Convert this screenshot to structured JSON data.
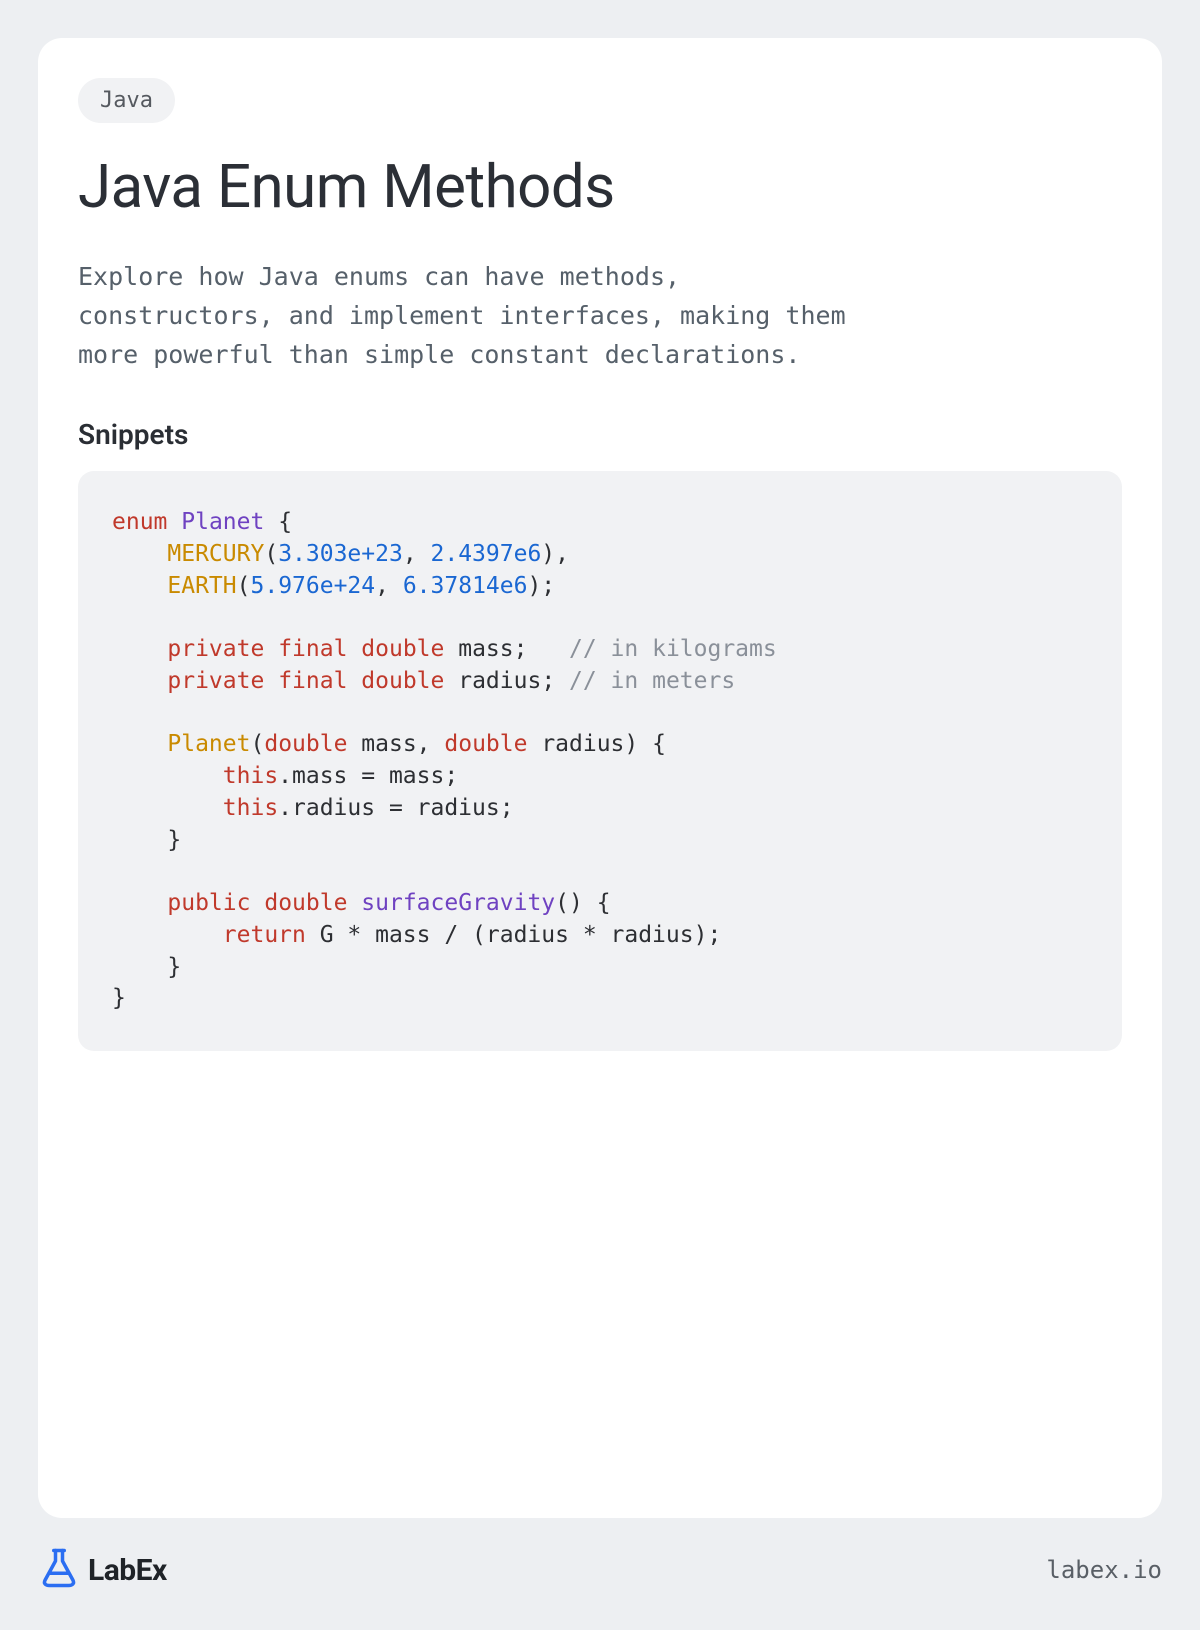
{
  "tag": "Java",
  "title": "Java Enum Methods",
  "description": "Explore how Java enums can have methods, constructors, and implement interfaces, making them more powerful than simple constant declarations.",
  "section_heading": "Snippets",
  "code": {
    "tokens": [
      {
        "t": "enum",
        "c": "tok-kw"
      },
      {
        "t": " "
      },
      {
        "t": "Planet",
        "c": "tok-type"
      },
      {
        "t": " {"
      },
      {
        "nl": true
      },
      {
        "t": "    "
      },
      {
        "t": "MERCURY",
        "c": "tok-const"
      },
      {
        "t": "("
      },
      {
        "t": "3.303e+23",
        "c": "tok-num"
      },
      {
        "t": ", "
      },
      {
        "t": "2.4397e6",
        "c": "tok-num"
      },
      {
        "t": "),"
      },
      {
        "nl": true
      },
      {
        "t": "    "
      },
      {
        "t": "EARTH",
        "c": "tok-const"
      },
      {
        "t": "("
      },
      {
        "t": "5.976e+24",
        "c": "tok-num"
      },
      {
        "t": ", "
      },
      {
        "t": "6.37814e6",
        "c": "tok-num"
      },
      {
        "t": ");"
      },
      {
        "nl": true
      },
      {
        "nl": true
      },
      {
        "t": "    "
      },
      {
        "t": "private",
        "c": "tok-kw"
      },
      {
        "t": " "
      },
      {
        "t": "final",
        "c": "tok-kw"
      },
      {
        "t": " "
      },
      {
        "t": "double",
        "c": "tok-kw"
      },
      {
        "t": " mass;   "
      },
      {
        "t": "// in kilograms",
        "c": "tok-cmt"
      },
      {
        "nl": true
      },
      {
        "t": "    "
      },
      {
        "t": "private",
        "c": "tok-kw"
      },
      {
        "t": " "
      },
      {
        "t": "final",
        "c": "tok-kw"
      },
      {
        "t": " "
      },
      {
        "t": "double",
        "c": "tok-kw"
      },
      {
        "t": " radius; "
      },
      {
        "t": "// in meters",
        "c": "tok-cmt"
      },
      {
        "nl": true
      },
      {
        "nl": true
      },
      {
        "t": "    "
      },
      {
        "t": "Planet",
        "c": "tok-const"
      },
      {
        "t": "("
      },
      {
        "t": "double",
        "c": "tok-kw"
      },
      {
        "t": " mass, "
      },
      {
        "t": "double",
        "c": "tok-kw"
      },
      {
        "t": " radius) {"
      },
      {
        "nl": true
      },
      {
        "t": "        "
      },
      {
        "t": "this",
        "c": "tok-kw"
      },
      {
        "t": ".mass = mass;"
      },
      {
        "nl": true
      },
      {
        "t": "        "
      },
      {
        "t": "this",
        "c": "tok-kw"
      },
      {
        "t": ".radius = radius;"
      },
      {
        "nl": true
      },
      {
        "t": "    }"
      },
      {
        "nl": true
      },
      {
        "nl": true
      },
      {
        "t": "    "
      },
      {
        "t": "public",
        "c": "tok-kw"
      },
      {
        "t": " "
      },
      {
        "t": "double",
        "c": "tok-kw"
      },
      {
        "t": " "
      },
      {
        "t": "surfaceGravity",
        "c": "tok-fn"
      },
      {
        "t": "() {"
      },
      {
        "nl": true
      },
      {
        "t": "        "
      },
      {
        "t": "return",
        "c": "tok-kw"
      },
      {
        "t": " G * mass / (radius * radius);"
      },
      {
        "nl": true
      },
      {
        "t": "    }"
      },
      {
        "nl": true
      },
      {
        "t": "}"
      }
    ]
  },
  "footer": {
    "brand": "LabEx",
    "site": "labex.io"
  }
}
